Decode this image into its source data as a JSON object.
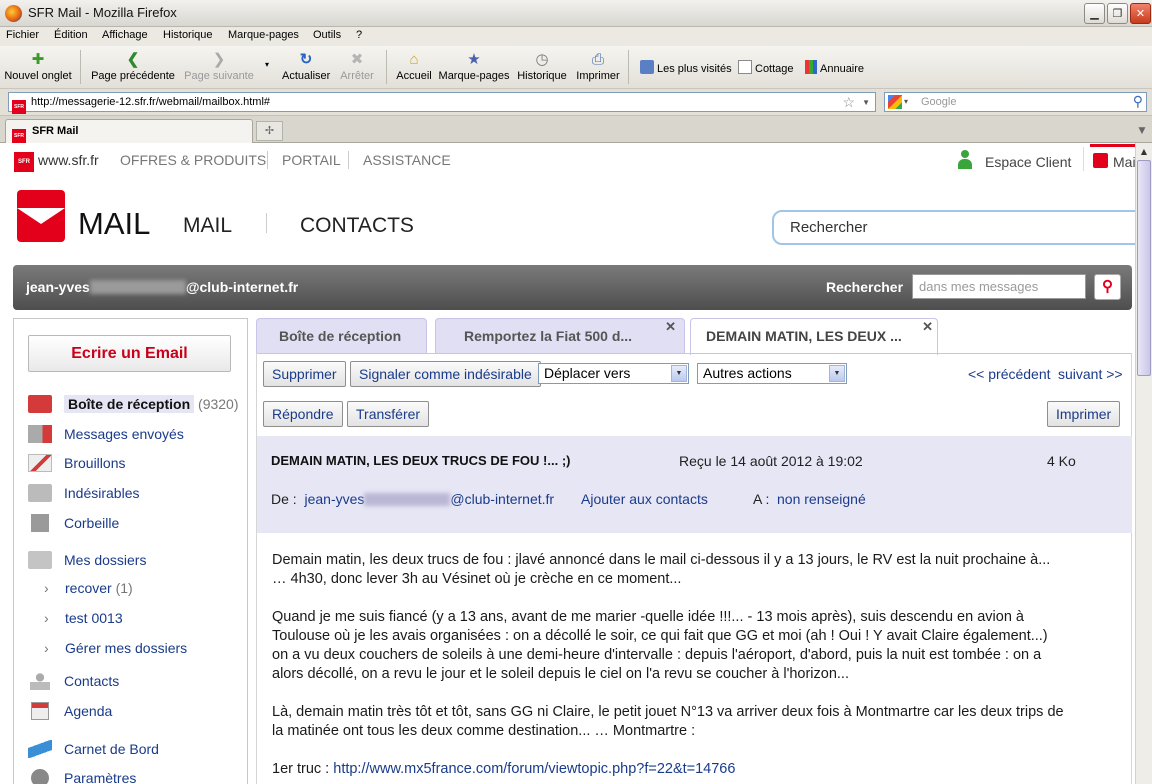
{
  "window": {
    "title": "SFR Mail - Mozilla Firefox",
    "minimize": "▁",
    "maximize": "❐",
    "close": "✕"
  },
  "menu": [
    "Fichier",
    "Édition",
    "Affichage",
    "Historique",
    "Marque-pages",
    "Outils",
    "?"
  ],
  "toolbar": {
    "new_tab": "Nouvel onglet",
    "back": "Page précédente",
    "forward": "Page suivante",
    "reload": "Actualiser",
    "stop": "Arrêter",
    "home": "Accueil",
    "bookmarks": "Marque-pages",
    "history": "Historique",
    "print": "Imprimer",
    "bookmark_links": [
      "Les plus visités",
      "Cottage",
      "Annuaire"
    ]
  },
  "address": {
    "url": "http://messagerie-12.sfr.fr/webmail/mailbox.html#",
    "search_placeholder": "Google"
  },
  "tabs": {
    "active": "SFR Mail",
    "new_tab_icon": "✢"
  },
  "site": {
    "nav": [
      "www.sfr.fr",
      "OFFRES & PRODUITS",
      "PORTAIL",
      "ASSISTANCE"
    ],
    "espace_client": "Espace Client",
    "mail_short": "Mai",
    "brand": "MAIL",
    "sections": [
      "MAIL",
      "CONTACTS"
    ],
    "search_placeholder": "Rechercher"
  },
  "userbar": {
    "user_prefix": "jean-yves",
    "user_suffix": "@club-internet.fr",
    "search_label": "Rechercher",
    "search_placeholder": "dans mes messages"
  },
  "sidebar": {
    "compose": "Ecrire un Email",
    "folders": [
      {
        "label": "Boîte de réception",
        "count": "(9320)"
      },
      {
        "label": "Messages envoyés"
      },
      {
        "label": "Brouillons"
      },
      {
        "label": "Indésirables"
      },
      {
        "label": "Corbeille"
      }
    ],
    "my_folders": "Mes dossiers",
    "subfolders": [
      {
        "label": "recover",
        "count": "(1)"
      },
      {
        "label": "test 0013"
      },
      {
        "label": "Gérer mes dossiers"
      }
    ],
    "extras": [
      "Contacts",
      "Agenda",
      "Carnet de Bord",
      "Paramètres"
    ]
  },
  "mail_tabs": [
    "Boîte de réception",
    "Remportez la Fiat 500 d...",
    "DEMAIN MATIN, LES DEUX ..."
  ],
  "actions": {
    "delete": "Supprimer",
    "spam": "Signaler comme indésirable",
    "move": "Déplacer vers",
    "other": "Autres actions",
    "prev": "<< précédent",
    "next": "suivant >>",
    "reply": "Répondre",
    "forward": "Transférer",
    "print": "Imprimer"
  },
  "message": {
    "subject": "DEMAIN MATIN, LES DEUX TRUCS DE FOU !... ;)",
    "received": "Reçu le 14 août 2012 à 19:02",
    "size": "4 Ko",
    "from_label": "De :",
    "from_prefix": "jean-yves",
    "from_suffix": "@club-internet.fr",
    "add_contact": "Ajouter aux contacts",
    "to_label": "A :",
    "to_value": "non renseigné",
    "paragraphs": [
      [
        "Demain matin, les deux trucs de fou : jlavé annoncé dans le mail ci-dessous il y a 13 jours, le RV est la nuit prochaine à...",
        "… 4h30, donc lever 3h au Vésinet où je crèche en ce moment..."
      ],
      [
        "Quand je me suis fiancé (y a 13 ans, avant de me marier -quelle idée !!!... - 13 mois après), suis descendu en avion à",
        "Toulouse où je les avais organisées : on a décollé le soir, ce qui fait que GG et moi (ah ! Oui ! Y avait Claire également...)",
        "on a vu deux couchers de soleils à une demi-heure d'intervalle : depuis l'aéroport, d'abord, puis la nuit est tombée : on a",
        "alors décollé, on a revu le jour et le soleil depuis le ciel on l'a revu se coucher à l'horizon..."
      ],
      [
        "Là, demain matin très tôt et tôt, sans GG ni Claire, le petit jouet N°13 va arriver deux fois à Montmartre car les deux trips de",
        "la matinée ont tous les deux comme destination... … Montmartre :"
      ]
    ],
    "first_trick_label": "1er truc : ",
    "first_trick_link": "http://www.mx5france.com/forum/viewtopic.php?f=22&t=14766"
  },
  "colors": {
    "sfr_red": "#e2001a",
    "link": "#1a3b8a",
    "header_bg": "#e7e6f5"
  }
}
